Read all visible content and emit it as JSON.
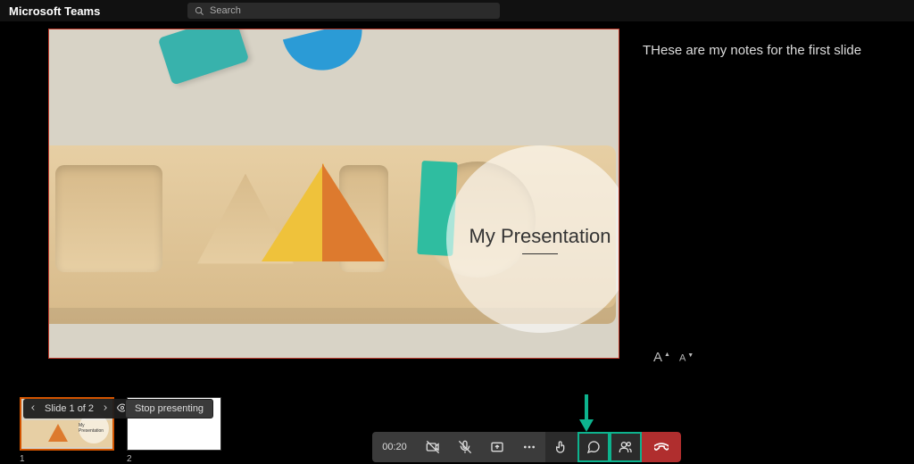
{
  "app": {
    "title": "Microsoft Teams"
  },
  "search": {
    "placeholder": "Search"
  },
  "presentation": {
    "title": "My Presentation",
    "notes": "THese are my notes for the first slide"
  },
  "slideNav": {
    "label": "Slide 1 of 2"
  },
  "stopPresentingLabel": "Stop presenting",
  "thumbnails": [
    {
      "index": "1",
      "selected": true
    },
    {
      "index": "2",
      "selected": false
    }
  ],
  "fontControls": {
    "increase": "A",
    "decrease": "A"
  },
  "call": {
    "duration": "00:20"
  }
}
